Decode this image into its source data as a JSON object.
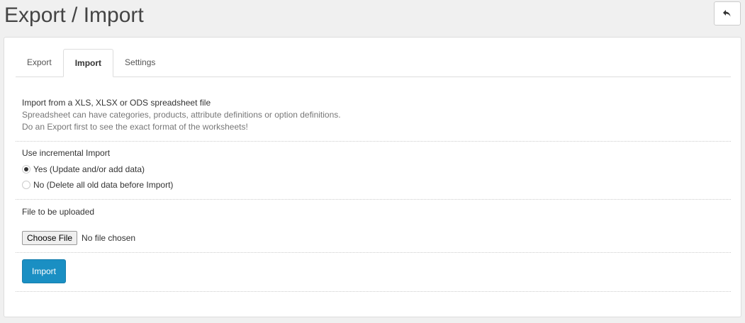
{
  "header": {
    "title": "Export / Import"
  },
  "tabs": [
    {
      "label": "Export"
    },
    {
      "label": "Import"
    },
    {
      "label": "Settings"
    }
  ],
  "active_tab": "Import",
  "intro": {
    "heading": "Import from a XLS, XLSX or ODS spreadsheet file",
    "line1": "Spreadsheet can have categories, products, attribute definitions or option definitions.",
    "line2": "Do an Export first to see the exact format of the worksheets!"
  },
  "incremental": {
    "label": "Use incremental Import",
    "options": [
      {
        "label": "Yes (Update and/or add data)",
        "checked": true
      },
      {
        "label": "No (Delete all old data before Import)",
        "checked": false
      }
    ]
  },
  "upload": {
    "label": "File to be uploaded",
    "button_label": "Choose File",
    "status": "No file chosen"
  },
  "submit": {
    "label": "Import"
  },
  "colors": {
    "primary": "#1a8fc3"
  }
}
